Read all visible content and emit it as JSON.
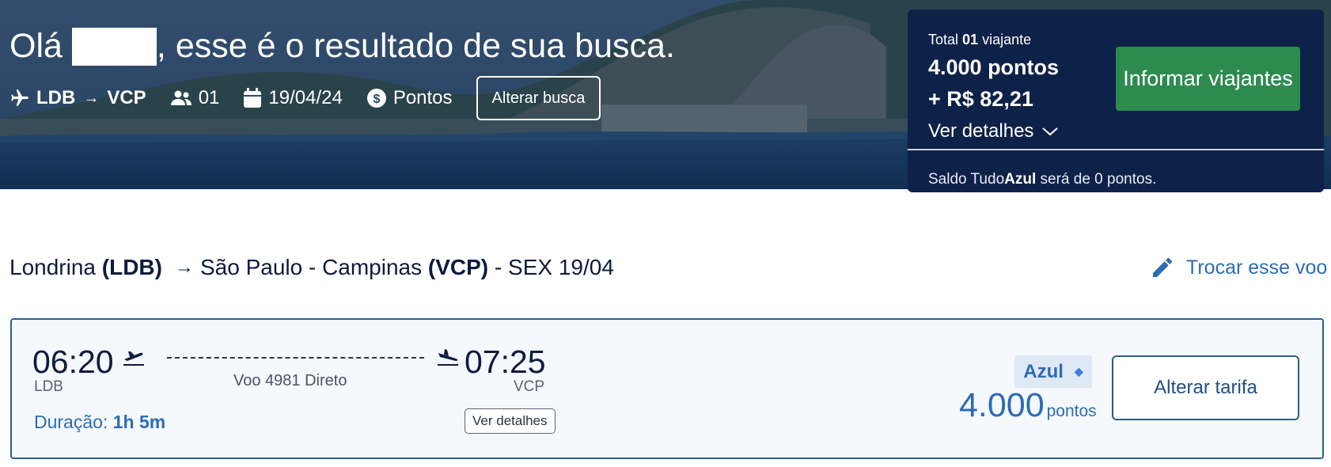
{
  "hero": {
    "greeting_prefix": "Olá",
    "greeting_suffix": ", esse é o resultado de sua busca.",
    "search": {
      "origin": "LDB",
      "arrow": "→",
      "destination": "VCP",
      "passengers": "01",
      "date": "19/04/24",
      "payment": "Pontos",
      "alter_button": "Alterar busca"
    }
  },
  "summary": {
    "total_prefix": "Total",
    "total_count": "01",
    "total_suffix": "viajante",
    "points": "4.000 pontos",
    "money": "+ R$ 82,21",
    "details_link": "Ver detalhes",
    "inform_button": "Informar viajantes",
    "balance_prefix": "Saldo Tudo",
    "balance_brand": "Azul",
    "balance_suffix": "será de 0 pontos."
  },
  "route": {
    "origin_city": "Londrina",
    "origin_code": "(LDB)",
    "arrow": "→",
    "destination_city": "São Paulo - Campinas",
    "destination_code": "(VCP)",
    "date_text": "- SEX 19/04",
    "swap_link": "Trocar esse voo"
  },
  "flight": {
    "departure_time": "06:20",
    "departure_code": "LDB",
    "arrival_time": "07:25",
    "arrival_code": "VCP",
    "info": "Voo 4981 Direto",
    "duration_label": "Duração:",
    "duration_value": "1h 5m",
    "details_button": "Ver detalhes",
    "fare_name": "Azul",
    "fare_icon": "diamond-icon",
    "price_amount": "4.000",
    "price_unit": "pontos",
    "alter_fare_button": "Alterar tarifa"
  },
  "colors": {
    "navy": "#0e2148",
    "accent_blue": "#2b6cb5",
    "green_button": "#2e8b4f",
    "card_border": "#2c5d8f"
  }
}
